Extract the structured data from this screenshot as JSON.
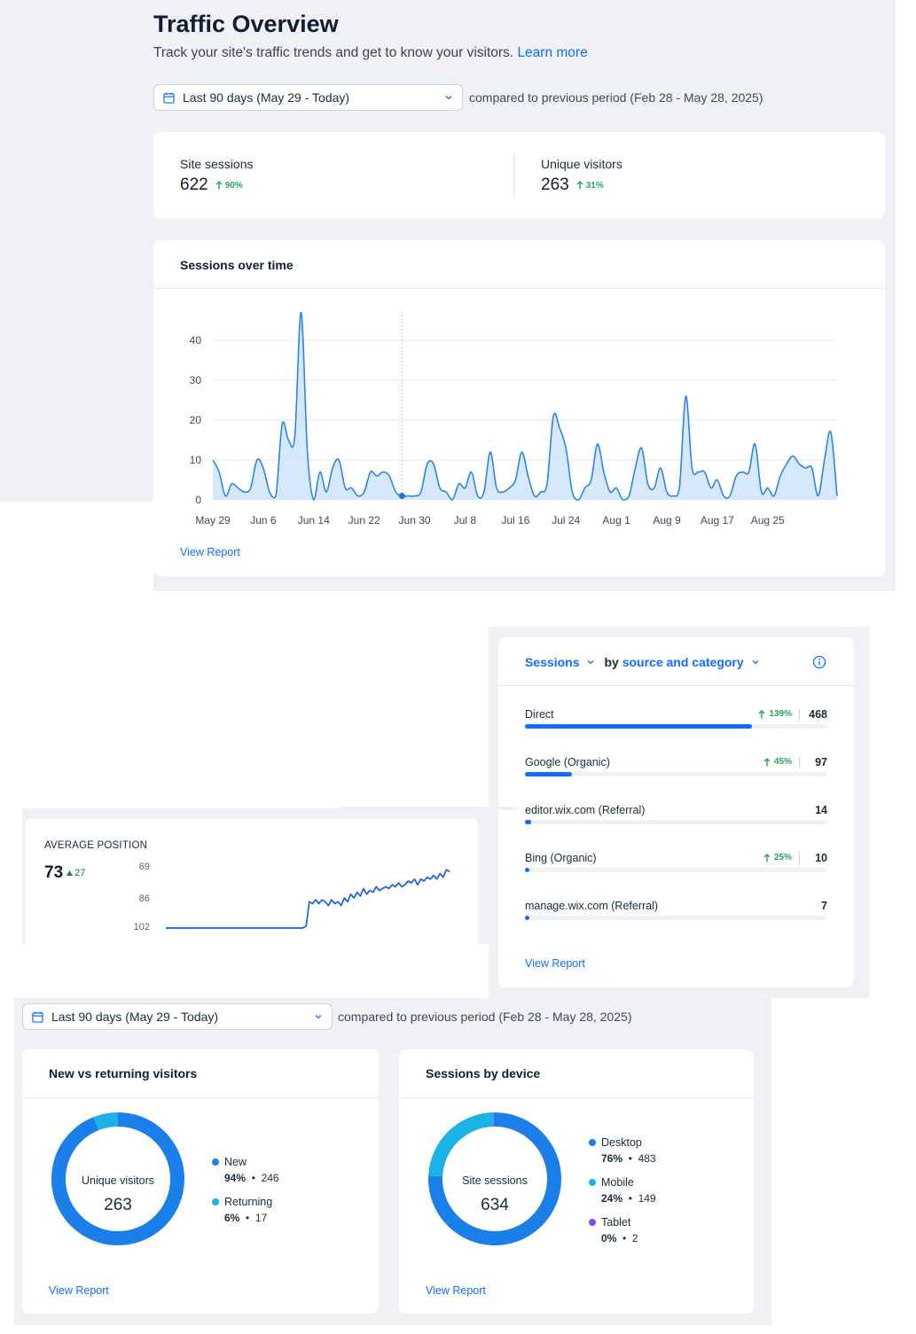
{
  "overview": {
    "title": "Traffic Overview",
    "subtitle": "Track your site's traffic trends and get to know your visitors.",
    "learn_more": "Learn more",
    "date_range": "Last 90 days (May 29 - Today)",
    "compared_to": "compared to previous period (Feb 28 - May 28, 2025)"
  },
  "kpis": [
    {
      "label": "Site sessions",
      "value": "622",
      "delta": "90%"
    },
    {
      "label": "Unique visitors",
      "value": "263",
      "delta": "31%"
    }
  ],
  "sessions_over_time": {
    "title": "Sessions over time",
    "view_report": "View Report",
    "chart_data": {
      "type": "area",
      "x_tick_labels": [
        "May 29",
        "Jun 6",
        "Jun 14",
        "Jun 22",
        "Jun 30",
        "Jul 8",
        "Jul 16",
        "Jul 24",
        "Aug 1",
        "Aug 9",
        "Aug 17",
        "Aug 25"
      ],
      "y_ticks": [
        0,
        10,
        20,
        30,
        40
      ],
      "ylim": [
        0,
        48
      ],
      "grid": true,
      "x_start": "May 29",
      "highlight_date": "Jun 30",
      "values": [
        10,
        7,
        1,
        4,
        3,
        2,
        3,
        10,
        8,
        2,
        1,
        19,
        15,
        16,
        47,
        12,
        0,
        7,
        2,
        8,
        10,
        3,
        3,
        1,
        2,
        7,
        6,
        7,
        6,
        2,
        1,
        1,
        1,
        2,
        9,
        9,
        3,
        2,
        0,
        4,
        3,
        7,
        1,
        2,
        12,
        3,
        2,
        3,
        5,
        12,
        6,
        1,
        2,
        4,
        21,
        18,
        13,
        2,
        0,
        3,
        5,
        14,
        7,
        2,
        3,
        0,
        1,
        8,
        13,
        4,
        3,
        8,
        2,
        1,
        3,
        26,
        8,
        7,
        7,
        3,
        5,
        1,
        1,
        6,
        7,
        7,
        14,
        2,
        3,
        1,
        6,
        9,
        11,
        9,
        8,
        8,
        1,
        10,
        17,
        1
      ]
    }
  },
  "sources": {
    "metric": "Sessions",
    "by_prefix": "by",
    "by_value": "source and category",
    "view_report": "View Report",
    "items": [
      {
        "name": "Direct",
        "delta": "139%",
        "count": "468",
        "share": 0.75
      },
      {
        "name": "Google (Organic)",
        "delta": "45%",
        "count": "97",
        "share": 0.155
      },
      {
        "name": "editor.wix.com (Referral)",
        "delta": "",
        "count": "14",
        "share": 0.02
      },
      {
        "name": "Bing (Organic)",
        "delta": "25%",
        "count": "10",
        "share": 0.015
      },
      {
        "name": "manage.wix.com (Referral)",
        "delta": "",
        "count": "7",
        "share": 0.01
      }
    ]
  },
  "average_position": {
    "title": "AVERAGE POSITION",
    "value": "73",
    "delta": "27",
    "chart_data": {
      "type": "line",
      "y_tick_labels": [
        "69",
        "86",
        "102"
      ],
      "y_inverted": true,
      "ylim": [
        102,
        69
      ],
      "values": [
        102,
        102,
        102,
        102,
        102,
        102,
        102,
        102,
        102,
        102,
        102,
        102,
        102,
        102,
        102,
        102,
        102,
        102,
        102,
        102,
        102,
        102,
        102,
        102,
        102,
        102,
        102,
        102,
        102,
        102,
        102,
        102,
        102,
        102,
        102,
        102,
        102,
        102,
        102,
        102,
        102,
        102,
        102,
        102,
        101,
        88,
        89,
        87,
        89,
        87,
        88,
        90,
        87,
        89,
        88,
        90,
        86,
        88,
        84,
        86,
        83,
        85,
        81,
        84,
        82,
        83,
        80,
        82,
        81,
        80,
        81,
        79,
        80,
        78,
        80,
        79,
        77,
        78,
        76,
        79,
        76,
        77,
        75,
        76,
        74,
        76,
        73,
        75,
        71,
        72
      ]
    }
  },
  "visitors": {
    "date_range": "Last 90 days (May 29 - Today)",
    "compared_to": "compared to previous period (Feb 28 - May 28, 2025)",
    "new_vs_returning": {
      "title": "New vs returning visitors",
      "center_label": "Unique visitors",
      "center_value": "263",
      "view_report": "View Report",
      "chart_data": {
        "type": "pie",
        "slices": [
          {
            "name": "New",
            "percent_label": "94%",
            "count": "246",
            "value": 94,
            "color": "#1a7fe8"
          },
          {
            "name": "Returning",
            "percent_label": "6%",
            "count": "17",
            "value": 6,
            "color": "#1bb2e6"
          }
        ]
      }
    },
    "by_device": {
      "title": "Sessions by device",
      "center_label": "Site sessions",
      "center_value": "634",
      "view_report": "View Report",
      "chart_data": {
        "type": "pie",
        "slices": [
          {
            "name": "Desktop",
            "percent_label": "76%",
            "count": "483",
            "value": 76,
            "color": "#1a7fe8"
          },
          {
            "name": "Mobile",
            "percent_label": "24%",
            "count": "149",
            "value": 24,
            "color": "#1bb2e6"
          },
          {
            "name": "Tablet",
            "percent_label": "0%",
            "count": "2",
            "value": 0.3,
            "color": "#7a4df0"
          }
        ]
      }
    }
  },
  "colors": {
    "accent": "#116dff",
    "positive": "#25a55a",
    "area_fill": "#cfe4fb",
    "line": "#2b86e3"
  },
  "icons": [
    "calendar-icon",
    "chevron-down-icon",
    "arrow-up-icon",
    "info-icon"
  ]
}
